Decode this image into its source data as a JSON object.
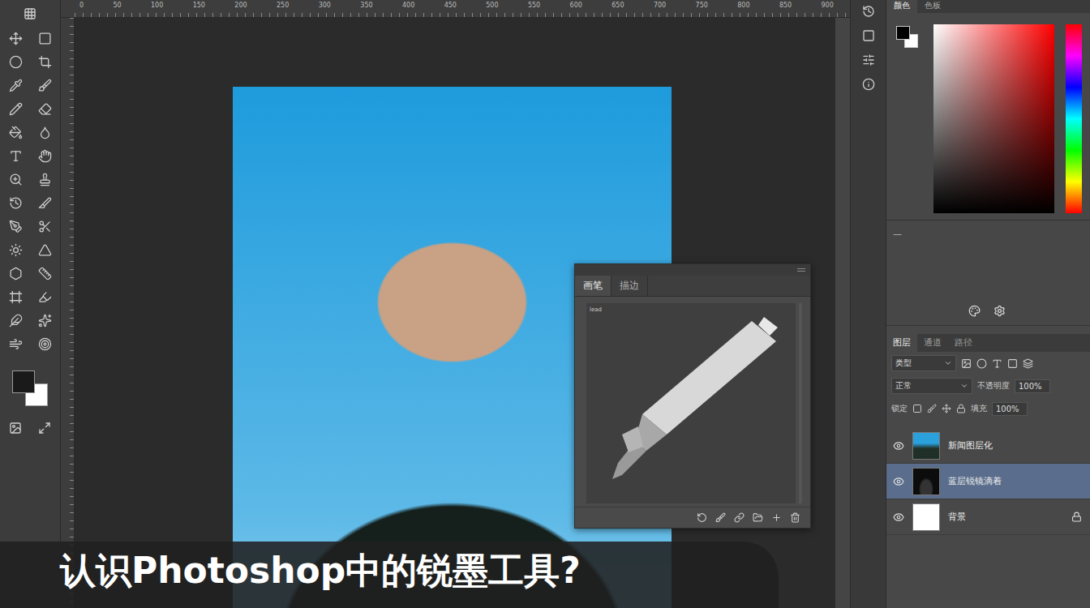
{
  "ruler": {
    "labels": [
      "0",
      "50",
      "100",
      "150",
      "200",
      "250",
      "300",
      "350",
      "400",
      "450",
      "500",
      "550",
      "600",
      "650",
      "700",
      "750",
      "800",
      "850",
      "900"
    ]
  },
  "brush_panel": {
    "tabs": [
      {
        "label": "画笔",
        "selected": true
      },
      {
        "label": "描边",
        "selected": false
      }
    ],
    "preset_name": "lead"
  },
  "color_panel": {
    "tabs": [
      {
        "label": "颜色",
        "selected": true
      },
      {
        "label": "色板",
        "selected": false
      }
    ],
    "divider_mark": "—"
  },
  "layers_panel": {
    "tabs": [
      {
        "label": "图层",
        "selected": true
      },
      {
        "label": "通道",
        "selected": false
      },
      {
        "label": "路径",
        "selected": false
      }
    ],
    "filter": "类型",
    "blend_mode": "正常",
    "opacity_label": "不透明度",
    "opacity": "100%",
    "lock_label": "锁定",
    "fill_label": "填充",
    "fill": "100%",
    "layers": [
      {
        "name": "新闻图层化",
        "kind": "photo",
        "visible": true,
        "selected": false,
        "locked": false
      },
      {
        "name": "蓝层锐镜滴着",
        "kind": "dark",
        "visible": true,
        "selected": true,
        "locked": false
      },
      {
        "name": "背景",
        "kind": "white",
        "visible": true,
        "selected": false,
        "locked": true
      }
    ]
  },
  "caption": "认识Photoshop中的锐墨工具?"
}
